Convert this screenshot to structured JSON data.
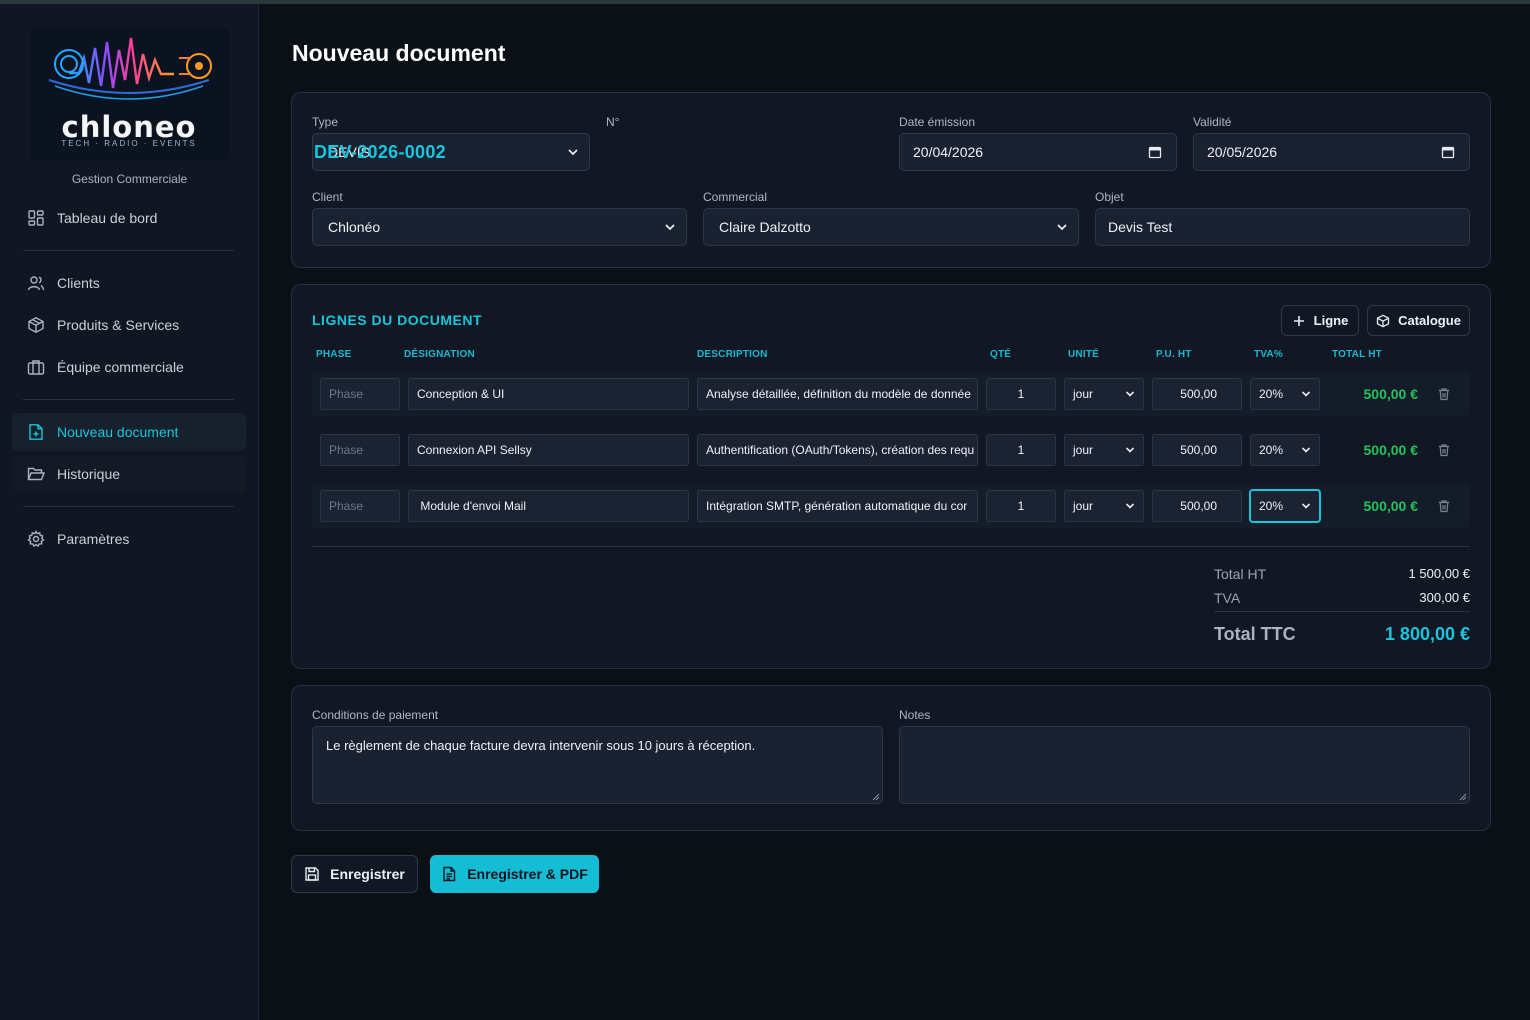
{
  "brand": {
    "logo_text": "chloneo",
    "logo_tagline": "TECH · RADIO · EVENTS",
    "subtitle": "Gestion Commerciale"
  },
  "nav": {
    "dashboard": "Tableau de bord",
    "clients": "Clients",
    "products": "Produits & Services",
    "team": "Équipe commerciale",
    "new_document": "Nouveau document",
    "history": "Historique",
    "settings": "Paramètres"
  },
  "page": {
    "title": "Nouveau document"
  },
  "form": {
    "type_label": "Type",
    "type_value": "DEVIS",
    "number_label": "N°",
    "number_value": "DEV-2026-0002",
    "date_label": "Date émission",
    "date_value": "20/04/2026",
    "validity_label": "Validité",
    "validity_value": "20/05/2026",
    "client_label": "Client",
    "client_value": "Chlonéo",
    "sales_label": "Commercial",
    "sales_value": "Claire Dalzotto",
    "object_label": "Objet",
    "object_value": "Devis Test"
  },
  "lines": {
    "title": "LIGNES DU DOCUMENT",
    "add_line": "Ligne",
    "catalogue": "Catalogue",
    "headers": {
      "phase": "PHASE",
      "designation": "DÉSIGNATION",
      "description": "DESCRIPTION",
      "qty": "QTÉ",
      "unit": "UNITÉ",
      "price": "P.U. HT",
      "vat": "TVA%",
      "total": "TOTAL HT"
    },
    "phase_placeholder": "Phase",
    "rows": [
      {
        "designation": "Conception & UI",
        "description": "Analyse détaillée, définition du modèle de donnée",
        "qty": "1",
        "unit": "jour",
        "price": "500,00",
        "vat": "20%",
        "total": "500,00 €"
      },
      {
        "designation": "Connexion API Sellsy",
        "description": "Authentification (OAuth/Tokens), création des requ",
        "qty": "1",
        "unit": "jour",
        "price": "500,00",
        "vat": "20%",
        "total": "500,00 €"
      },
      {
        "designation": " Module d'envoi Mail",
        "description": "Intégration SMTP, génération automatique du cor",
        "qty": "1",
        "unit": "jour",
        "price": "500,00",
        "vat": "20%",
        "total": "500,00 €"
      }
    ]
  },
  "totals": {
    "ht_label": "Total HT",
    "ht_value": "1 500,00 €",
    "tva_label": "TVA",
    "tva_value": "300,00 €",
    "ttc_label": "Total TTC",
    "ttc_value": "1 800,00 €"
  },
  "extra": {
    "payment_label": "Conditions de paiement",
    "payment_value": "Le règlement de chaque facture devra intervenir sous 10 jours à réception.",
    "notes_label": "Notes",
    "notes_value": ""
  },
  "actions": {
    "save": "Enregistrer",
    "save_pdf": "Enregistrer & PDF"
  },
  "colors": {
    "accent": "#19c5dc",
    "success": "#22c35e",
    "background": "#0b0f16"
  }
}
